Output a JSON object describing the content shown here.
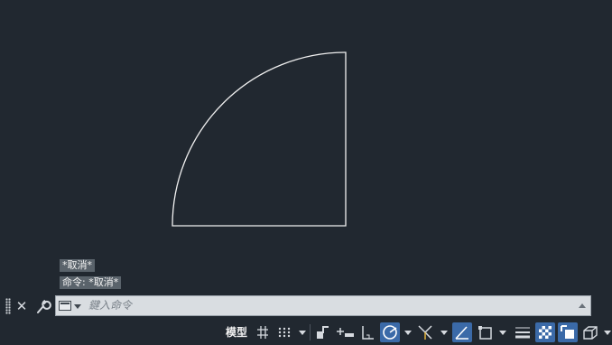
{
  "command_history": [
    "*取消*",
    "命令: *取消*"
  ],
  "command_line": {
    "placeholder": "鍵入命令"
  },
  "status_bar": {
    "model_label": "模型"
  },
  "colors": {
    "drawing_background": "#212830",
    "geometry_stroke": "#f0f0f0",
    "active_toggle": "#3b6aa8"
  },
  "icons": [
    "close-icon",
    "customize-wrench-icon",
    "command-window-icon",
    "grid-icon",
    "snap-icon",
    "ortho-icon",
    "polar-tracking-icon",
    "isodraft-icon",
    "object-snap-icon",
    "annotation-visibility-icon",
    "dynamic-ucs-icon",
    "selection-cycling-icon",
    "lineweight-icon",
    "transparency-icon",
    "quick-properties-icon",
    "3d-object-snap-icon"
  ]
}
